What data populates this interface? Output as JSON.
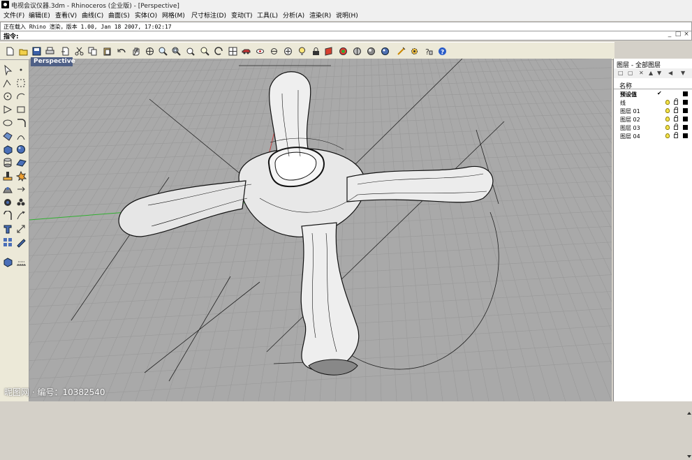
{
  "window": {
    "title": "电视会议仪器.3dm - Rhinoceros (企业版) - [Perspective]"
  },
  "menu": {
    "items": [
      "文件(F)",
      "编辑(E)",
      "查看(V)",
      "曲线(C)",
      "曲面(S)",
      "实体(O)",
      "网格(M)",
      "尺寸标注(D)",
      "变动(T)",
      "工具(L)",
      "分析(A)",
      "渲染(R)",
      "说明(H)"
    ]
  },
  "command": {
    "history": "正在载入 Rhino 渲染，版本 1.00, Jan 18 2007, 17:02:17",
    "prompt": "指令:",
    "value": ""
  },
  "window_controls": {
    "minimize": "_",
    "maximize": "□",
    "close": "×"
  },
  "toolbar": {
    "icons": [
      "new-file-icon",
      "open-file-icon",
      "save-icon",
      "print-icon",
      "import-icon",
      "cut-icon",
      "copy-icon",
      "paste-icon",
      "undo-icon",
      "pan-icon",
      "rotate-view-icon",
      "zoom-window-icon",
      "zoom-extents-icon",
      "zoom-selected-icon",
      "zoom-dynamic-icon",
      "undo-view-icon",
      "four-viewports-icon",
      "car-icon",
      "named-views-icon",
      "point-edit-icon",
      "light-bulb-icon",
      "lock-icon",
      "layer-icon",
      "render-color-icon",
      "shaded-view-icon",
      "render-icon",
      "material-sphere-icon",
      "options-icon",
      "gear-icon",
      "help-icon",
      "question-icon"
    ]
  },
  "left_toolbox": {
    "icons": [
      "select-arrow-icon",
      "point-icon",
      "polyline-icon",
      "curve-icon",
      "circle-icon",
      "arc-icon",
      "ellipse-icon",
      "rectangle-icon",
      "polygon-icon",
      "fillet-icon",
      "freeform-icon",
      "rail-icon",
      "box-icon",
      "sphere-icon",
      "cylinder-icon",
      "plane-icon",
      "boolean-icon",
      "explode-icon",
      "solid-icon",
      "group-icon",
      "move-icon",
      "rotate-icon",
      "text-icon",
      "dimension-icon",
      "array-icon",
      "scale-icon",
      "block-icon",
      "hatch-icon"
    ]
  },
  "viewport": {
    "label": "Perspective",
    "background": "#a9a9a9",
    "grid_color": "#999999",
    "axis_x_color": "#c04040",
    "axis_y_color": "#30b030"
  },
  "layers": {
    "title": "图层 - 全部图层",
    "tools": [
      "□",
      "▢",
      "✕",
      "▲",
      "▼",
      "◀",
      "▼"
    ],
    "column_name": "名称",
    "rows": [
      {
        "name": "预设值",
        "current": true,
        "check": "✔",
        "color": "#000000"
      },
      {
        "name": "线",
        "current": false,
        "check": "",
        "color": "#000000"
      },
      {
        "name": "图层 01",
        "current": false,
        "check": "",
        "color": "#000000"
      },
      {
        "name": "图层 02",
        "current": false,
        "check": "",
        "color": "#000000"
      },
      {
        "name": "图层 03",
        "current": false,
        "check": "",
        "color": "#000000"
      },
      {
        "name": "图层 04",
        "current": false,
        "check": "",
        "color": "#000000"
      }
    ]
  },
  "watermark": {
    "text": "昵图网 · 编号：10382540"
  }
}
